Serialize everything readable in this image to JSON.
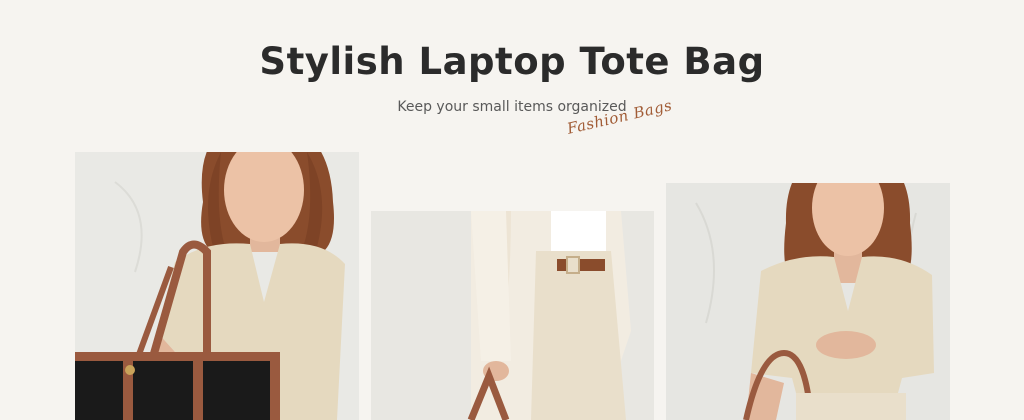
{
  "header": {
    "title": "Stylish Laptop Tote Bag",
    "subtitle": "Keep your small items organized",
    "script_logo": "Fashion Bags"
  },
  "colors": {
    "background": "#f6f4f0",
    "title": "#2b2b2b",
    "accent_script": "#a15c36",
    "bag_strap": "#9a5a3f",
    "bag_body": "#1a1a1a",
    "sweater": "#e5d9bf",
    "hair": "#8a4c2c"
  },
  "gallery": {
    "items": [
      {
        "name": "model-with-black-tote"
      },
      {
        "name": "outfit-closeup-cream-coat"
      },
      {
        "name": "model-holding-tote"
      }
    ]
  }
}
